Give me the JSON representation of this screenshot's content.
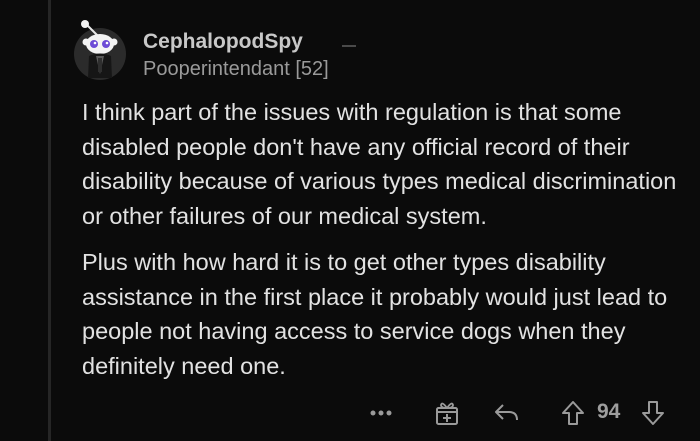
{
  "comment": {
    "username": "CephalopodSpy",
    "flair": "Pooperintendant [52]",
    "paragraphs": [
      "I think part of the issues with regulation is that some disabled people don't have any official record of their disability because of various types medical discrimination or other failures of our medical system.",
      "Plus with how hard it is to get other types disability assistance in the first place it probably would just lead to people not having access to service dogs when they definitely need one."
    ],
    "score": "94"
  },
  "actions": {
    "more_icon": "more-options-icon",
    "award_icon": "award-icon",
    "reply_icon": "reply-icon",
    "upvote_icon": "upvote-arrow-icon",
    "downvote_icon": "downvote-arrow-icon"
  },
  "colors": {
    "background": "#0b0b0b",
    "text": "#e2e2e2",
    "muted": "#9a9a9a",
    "avatar_accent": "#6c4bd6"
  }
}
